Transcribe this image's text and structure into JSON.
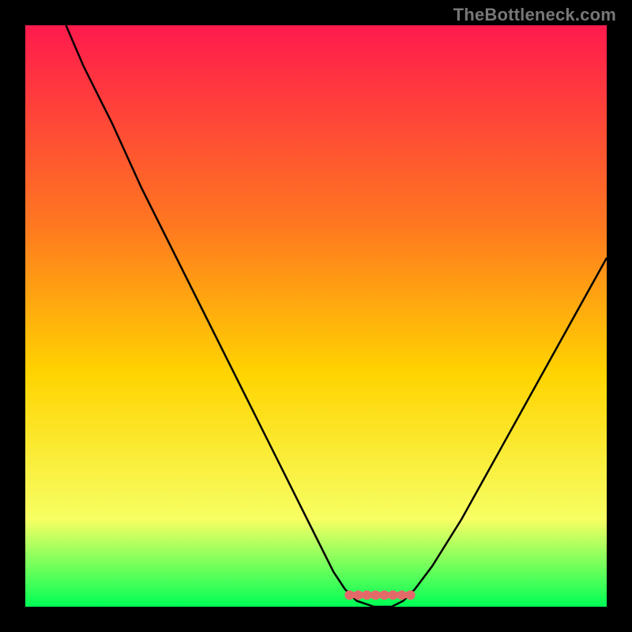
{
  "watermark": "TheBottleneck.com",
  "colors": {
    "background_black": "#000000",
    "gradient_top": "#ff1a4d",
    "gradient_mid1": "#ff7a1f",
    "gradient_mid2": "#ffd400",
    "gradient_low": "#f7ff63",
    "gradient_bottom": "#00ff55",
    "curve": "#000000",
    "marker": "#e46a6a",
    "watermark": "#777777"
  },
  "chart_data": {
    "type": "line",
    "title": "",
    "xlabel": "",
    "ylabel": "",
    "xlim": [
      0,
      100
    ],
    "ylim": [
      0,
      100
    ],
    "series": [
      {
        "name": "bottleneck-curve",
        "x": [
          7,
          10,
          15,
          20,
          25,
          30,
          35,
          40,
          45,
          50,
          53,
          55,
          57,
          60,
          63,
          65,
          67,
          70,
          75,
          80,
          85,
          90,
          95,
          100
        ],
        "values": [
          100,
          93,
          83,
          72,
          62,
          52,
          42,
          32,
          22,
          12,
          6,
          3,
          1,
          0,
          0,
          1,
          3,
          7,
          15,
          24,
          33,
          42,
          51,
          60
        ]
      }
    ],
    "annotations": [
      {
        "name": "optimal-region-marker",
        "x_range": [
          55,
          67
        ],
        "y": 2
      }
    ],
    "legend": false,
    "grid": false
  }
}
